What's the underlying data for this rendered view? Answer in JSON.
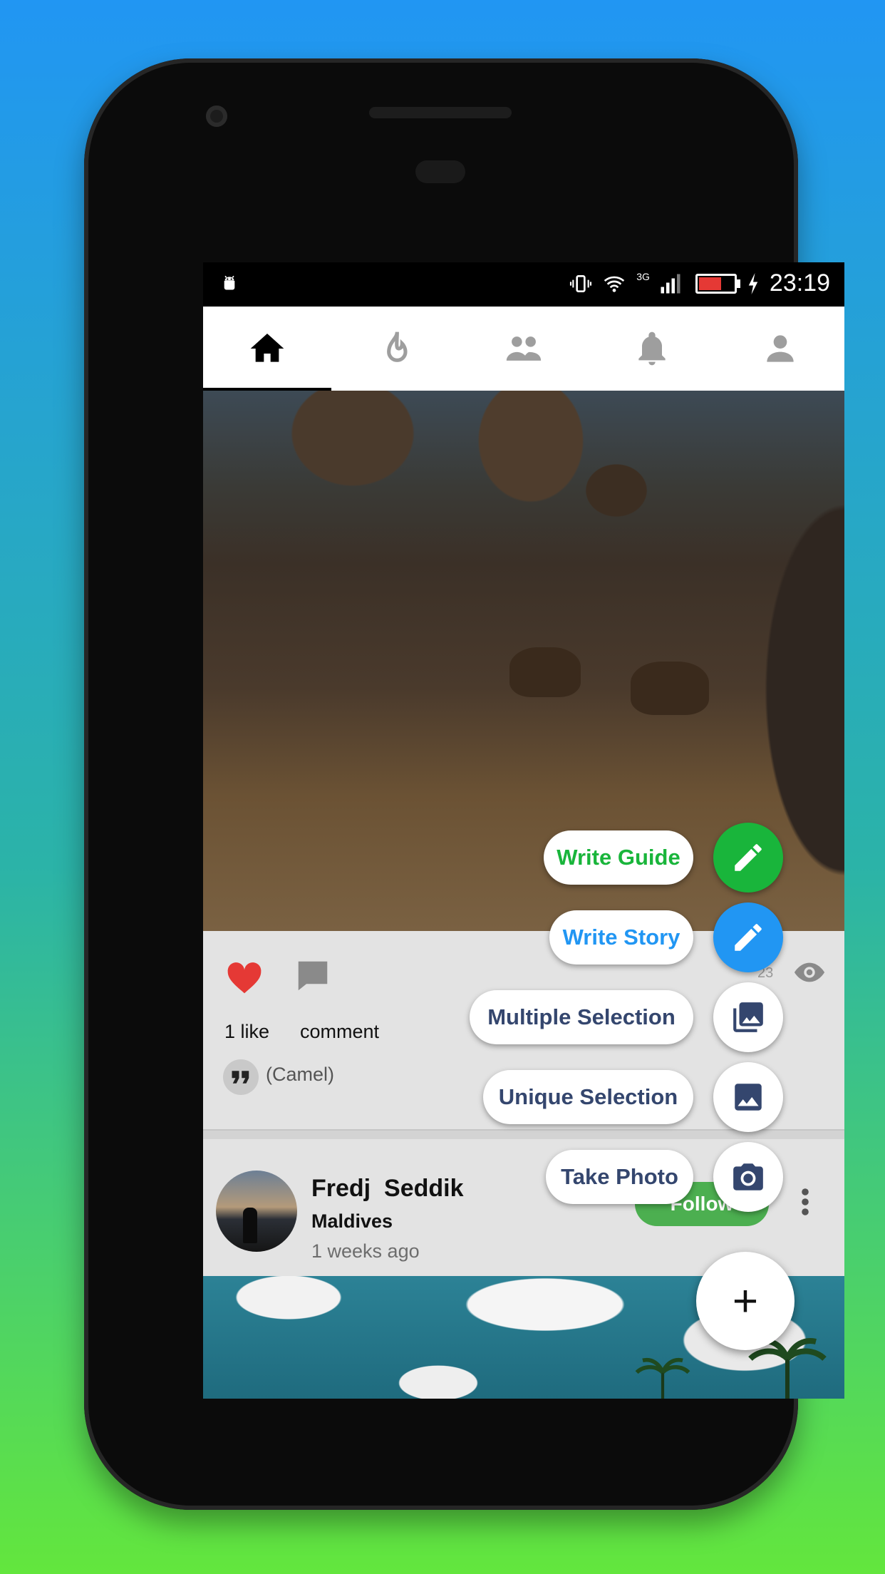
{
  "status_bar": {
    "time": "23:19",
    "network_label": "3G"
  },
  "nav_tabs": [
    {
      "name": "home-icon",
      "active": true
    },
    {
      "name": "fire-icon",
      "active": false
    },
    {
      "name": "people-icon",
      "active": false
    },
    {
      "name": "bell-icon",
      "active": false
    },
    {
      "name": "person-icon",
      "active": false
    }
  ],
  "post1": {
    "likes_text": "1 like",
    "comment_text": "comment",
    "caption": "(Camel)",
    "views": "23"
  },
  "post2": {
    "author": "Fredj  Seddik",
    "location": "Maldives",
    "time_ago": "1 weeks ago",
    "follow_label": "Follow"
  },
  "fab_menu": {
    "items": [
      {
        "label": "Write Guide",
        "color": "#19b53b",
        "icon": "pencil-icon"
      },
      {
        "label": "Write Story",
        "color": "#2196F3",
        "icon": "pencil-icon"
      },
      {
        "label": "Multiple Selection",
        "color": "#34466e",
        "icon": "photo-library-icon"
      },
      {
        "label": "Unique Selection",
        "color": "#34466e",
        "icon": "image-icon"
      },
      {
        "label": "Take Photo",
        "color": "#34466e",
        "icon": "camera-icon"
      }
    ],
    "main_symbol": "+"
  },
  "colors": {
    "heart": "#e53935",
    "follow_button": "#4caf50"
  }
}
